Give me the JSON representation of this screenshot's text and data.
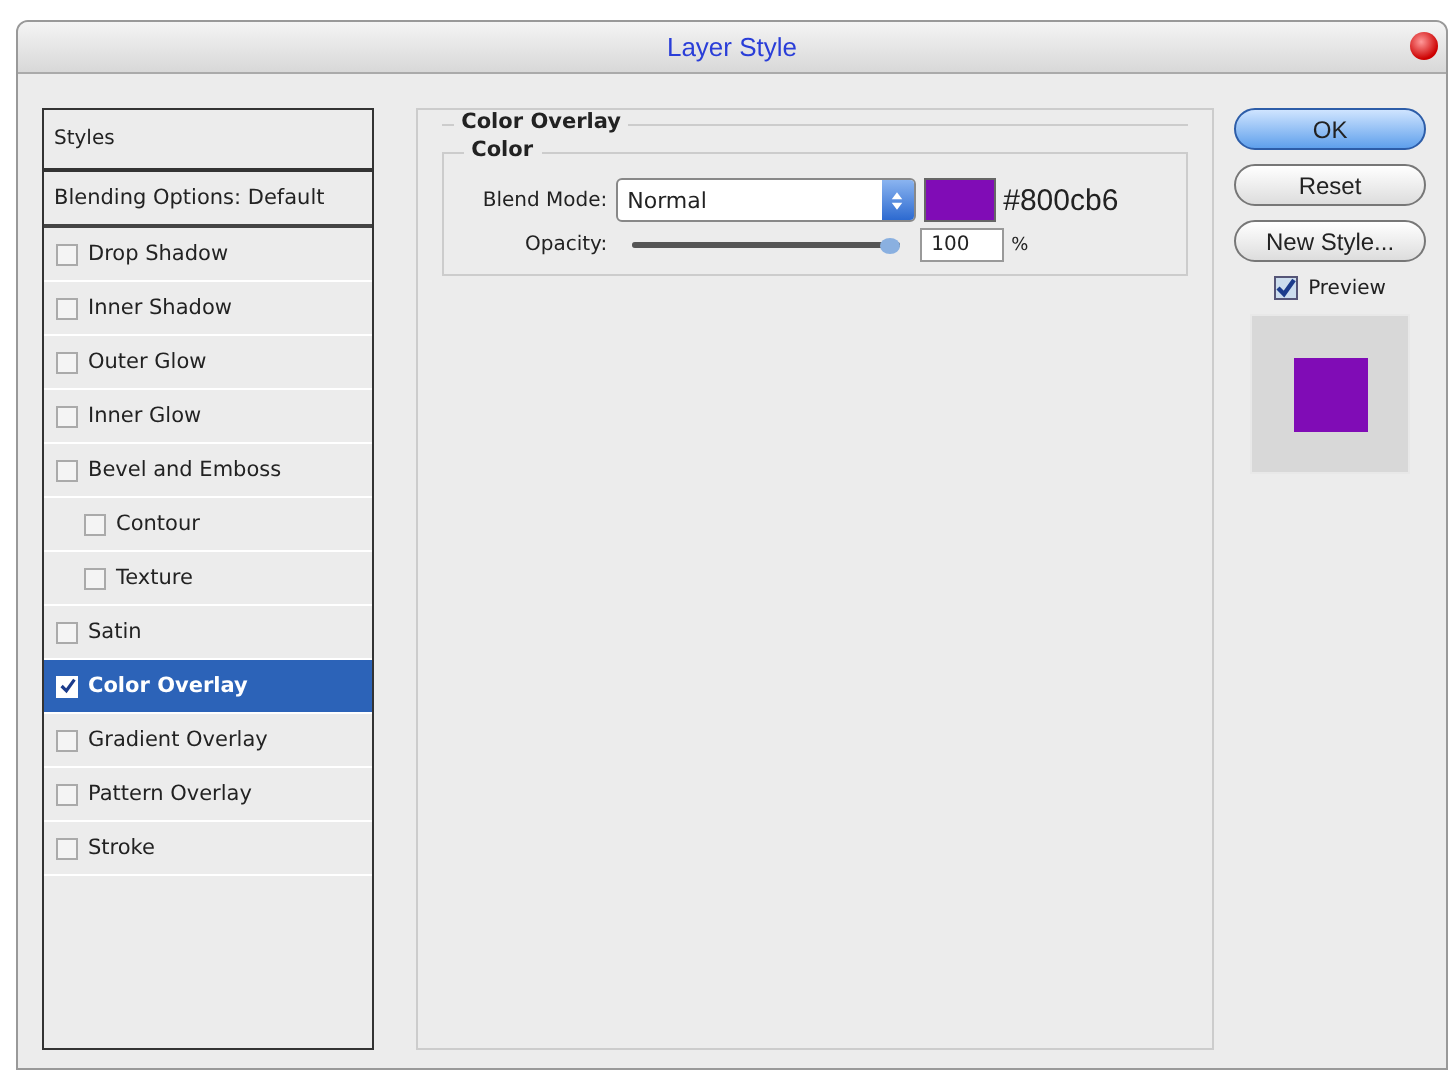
{
  "window": {
    "title": "Layer Style"
  },
  "styles": {
    "header": "Styles",
    "blending": "Blending Options: Default",
    "items": [
      {
        "label": "Drop Shadow",
        "checked": false,
        "selected": false
      },
      {
        "label": "Inner Shadow",
        "checked": false,
        "selected": false
      },
      {
        "label": "Outer Glow",
        "checked": false,
        "selected": false
      },
      {
        "label": "Inner Glow",
        "checked": false,
        "selected": false
      },
      {
        "label": "Bevel and Emboss",
        "checked": false,
        "selected": false,
        "children": [
          {
            "label": "Contour",
            "checked": false,
            "selected": false
          },
          {
            "label": "Texture",
            "checked": false,
            "selected": false
          }
        ]
      },
      {
        "label": "Satin",
        "checked": false,
        "selected": false
      },
      {
        "label": "Color Overlay",
        "checked": true,
        "selected": true
      },
      {
        "label": "Gradient Overlay",
        "checked": false,
        "selected": false
      },
      {
        "label": "Pattern Overlay",
        "checked": false,
        "selected": false
      },
      {
        "label": "Stroke",
        "checked": false,
        "selected": false
      }
    ]
  },
  "panel": {
    "title": "Color Overlay",
    "group": "Color",
    "blend_label": "Blend Mode:",
    "blend_value": "Normal",
    "color": "#800cb6",
    "color_text": "#800cb6",
    "opacity_label": "Opacity:",
    "opacity": {
      "level": 1.0
    },
    "opacity_value": "100",
    "opacity_unit": "%"
  },
  "buttons": [
    {
      "label": "OK",
      "kind": "default"
    },
    {
      "label": "Reset",
      "kind": "normal"
    },
    {
      "label": "New Style...",
      "kind": "normal"
    }
  ],
  "preview": {
    "label": "Preview",
    "checked": true
  }
}
